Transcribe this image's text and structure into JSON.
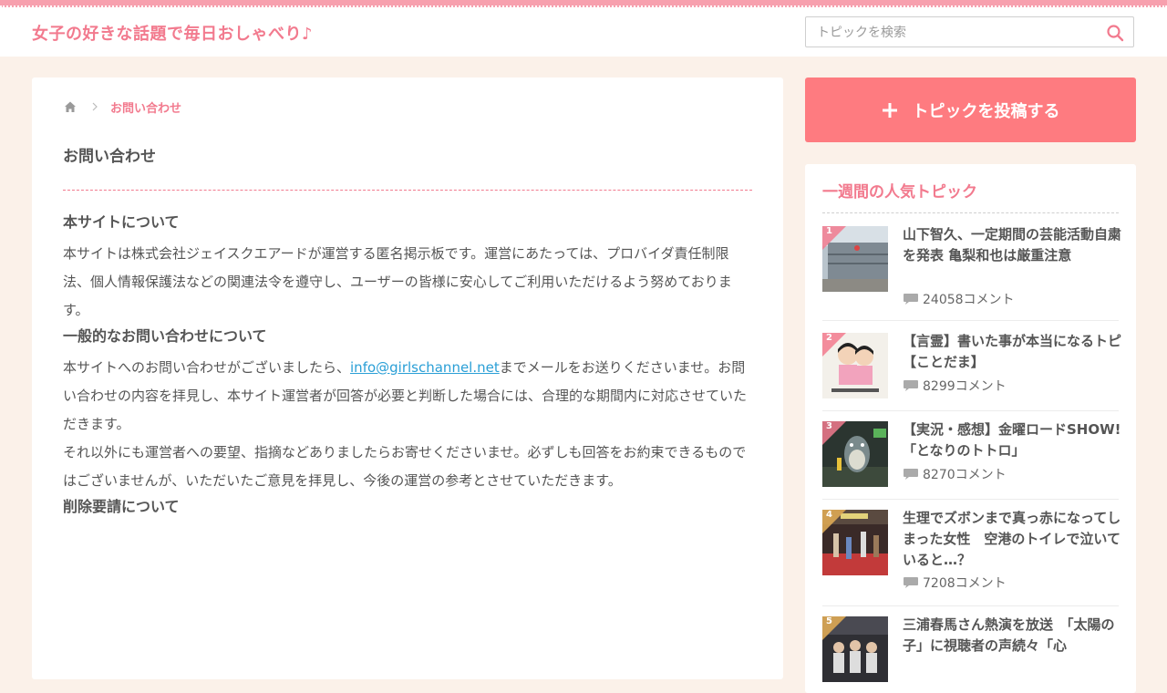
{
  "header": {
    "site_title": "女子の好きな話題で毎日おしゃべり♪",
    "search_placeholder": "トピックを検索",
    "search_icon": "search-icon"
  },
  "breadcrumb": {
    "home_icon": "home-icon",
    "current": "お問い合わせ"
  },
  "page": {
    "title": "お問い合わせ",
    "sections": [
      {
        "heading": "本サイトについて",
        "body": "本サイトは株式会社ジェイスクエアードが運営する匿名掲示板です。運営にあたっては、プロバイダ責任制限法、個人情報保護法などの関連法令を遵守し、ユーザーの皆様に安心してご利用いただけるよう努めております。"
      },
      {
        "heading": "一般的なお問い合わせについて",
        "body_before_link": "本サイトへのお問い合わせがございましたら、",
        "link": "info@girlschannel.net",
        "body_after_link": "までメールをお送りくださいませ。お問い合わせの内容を拝見し、本サイト運営者が回答が必要と判断した場合には、合理的な期間内に対応させていただきます。",
        "body2": "それ以外にも運営者への要望、指摘などありましたらお寄せくださいませ。必ずしも回答をお約束できるものではございませんが、いただいたご意見を拝見し、今後の運営の参考とさせていただきます。"
      },
      {
        "heading": "削除要請について"
      }
    ]
  },
  "sidebar": {
    "post_button": "トピックを投稿する",
    "ranking_title": "一週間の人気トピック",
    "items": [
      {
        "rank": "1",
        "title": "山下智久、一定期間の芸能活動自粛を発表 亀梨和也は厳重注意",
        "comments": "24058コメント"
      },
      {
        "rank": "2",
        "title": "【言霊】書いた事が本当になるトピ【ことだま】",
        "comments": "8299コメント"
      },
      {
        "rank": "3",
        "title": "【実況・感想】金曜ロードSHOW!「となりのトトロ」",
        "comments": "8270コメント"
      },
      {
        "rank": "4",
        "title": "生理でズボンまで真っ赤になってしまった女性　空港のトイレで泣いていると…？",
        "comments": "7208コメント"
      },
      {
        "rank": "5",
        "title": "三浦春馬さん熱演を放送　「太陽の子」に視聴者の声続々「心",
        "comments": ""
      }
    ]
  },
  "colors": {
    "accent": "#f27a8e",
    "post_button": "#fe7b80",
    "background": "#fbf1e9"
  }
}
